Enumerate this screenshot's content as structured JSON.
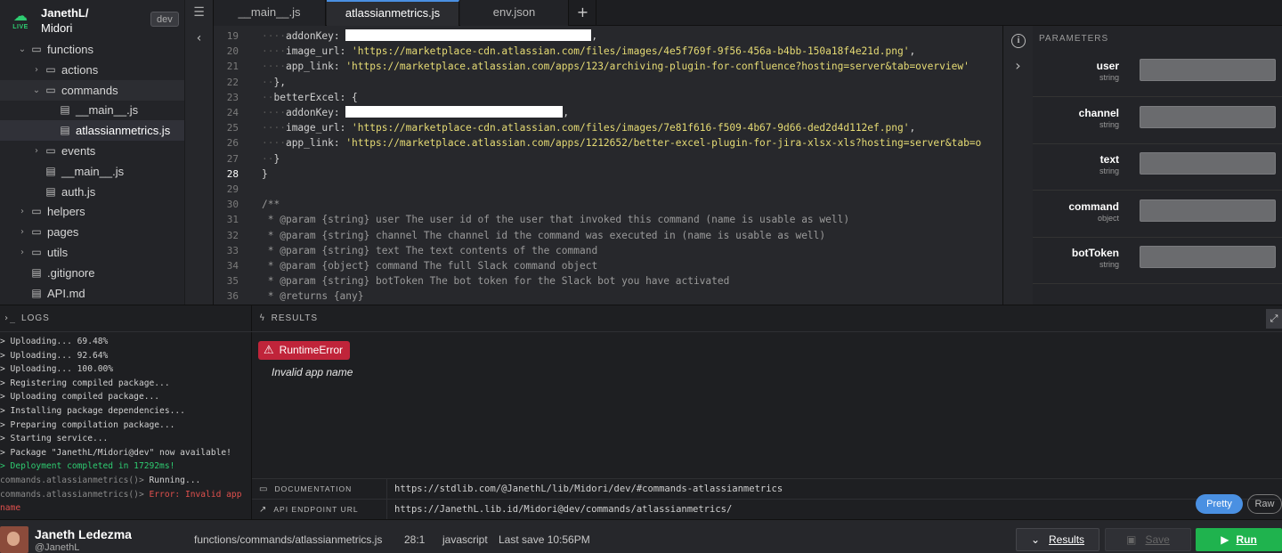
{
  "project": {
    "owner": "JanethL/",
    "app": "Midori",
    "env": "dev",
    "live_label": "LIVE"
  },
  "tree": [
    {
      "label": "functions",
      "type": "folder",
      "depth": 1,
      "open": true
    },
    {
      "label": "actions",
      "type": "folder",
      "depth": 2,
      "open": false
    },
    {
      "label": "commands",
      "type": "folder",
      "depth": 2,
      "open": true
    },
    {
      "label": "__main__.js",
      "type": "file",
      "depth": 3
    },
    {
      "label": "atlassianmetrics.js",
      "type": "file",
      "depth": 3,
      "active": true
    },
    {
      "label": "events",
      "type": "folder",
      "depth": 2,
      "open": false
    },
    {
      "label": "__main__.js",
      "type": "file",
      "depth": 2
    },
    {
      "label": "auth.js",
      "type": "file",
      "depth": 2
    },
    {
      "label": "helpers",
      "type": "folder",
      "depth": 1,
      "open": false
    },
    {
      "label": "pages",
      "type": "folder",
      "depth": 1,
      "open": false
    },
    {
      "label": "utils",
      "type": "folder",
      "depth": 1,
      "open": false
    },
    {
      "label": ".gitignore",
      "type": "file",
      "depth": 1
    },
    {
      "label": "API.md",
      "type": "file",
      "depth": 1
    }
  ],
  "tabs": [
    {
      "label": "__main__.js",
      "active": false
    },
    {
      "label": "atlassianmetrics.js",
      "active": true
    },
    {
      "label": "env.json",
      "active": false
    }
  ],
  "add_tab": "+",
  "editor": {
    "current_line": 28,
    "lines": [
      {
        "n": 19,
        "segs": [
          {
            "t": "ws",
            "v": "····"
          },
          {
            "t": "p",
            "v": "addonKey: "
          },
          {
            "t": "redact",
            "w": 276
          },
          {
            "t": "p",
            "v": ","
          }
        ]
      },
      {
        "n": 20,
        "segs": [
          {
            "t": "ws",
            "v": "····"
          },
          {
            "t": "p",
            "v": "image_url: "
          },
          {
            "t": "str",
            "v": "'https://marketplace-cdn.atlassian.com/files/images/4e5f769f-9f56-456a-b4bb-150a18f4e21d.png'"
          },
          {
            "t": "p",
            "v": ","
          }
        ]
      },
      {
        "n": 21,
        "segs": [
          {
            "t": "ws",
            "v": "····"
          },
          {
            "t": "p",
            "v": "app_link: "
          },
          {
            "t": "str",
            "v": "'https://marketplace.atlassian.com/apps/123/archiving-plugin-for-confluence?hosting=server&tab=overview'"
          }
        ]
      },
      {
        "n": 22,
        "segs": [
          {
            "t": "ws",
            "v": "··"
          },
          {
            "t": "p",
            "v": "},"
          }
        ]
      },
      {
        "n": 23,
        "segs": [
          {
            "t": "ws",
            "v": "··"
          },
          {
            "t": "p",
            "v": "betterExcel: {"
          }
        ]
      },
      {
        "n": 24,
        "segs": [
          {
            "t": "ws",
            "v": "····"
          },
          {
            "t": "p",
            "v": "addonKey: "
          },
          {
            "t": "redact",
            "w": 244
          },
          {
            "t": "p",
            "v": ","
          }
        ]
      },
      {
        "n": 25,
        "segs": [
          {
            "t": "ws",
            "v": "····"
          },
          {
            "t": "p",
            "v": "image_url: "
          },
          {
            "t": "str",
            "v": "'https://marketplace-cdn.atlassian.com/files/images/7e81f616-f509-4b67-9d66-ded2d4d112ef.png'"
          },
          {
            "t": "p",
            "v": ","
          }
        ]
      },
      {
        "n": 26,
        "segs": [
          {
            "t": "ws",
            "v": "····"
          },
          {
            "t": "p",
            "v": "app_link: "
          },
          {
            "t": "str",
            "v": "'https://marketplace.atlassian.com/apps/1212652/better-excel-plugin-for-jira-xlsx-xls?hosting=server&tab=o"
          }
        ]
      },
      {
        "n": 27,
        "segs": [
          {
            "t": "ws",
            "v": "··"
          },
          {
            "t": "p",
            "v": "}"
          }
        ]
      },
      {
        "n": 28,
        "segs": [
          {
            "t": "p",
            "v": "}"
          }
        ]
      },
      {
        "n": 29,
        "segs": []
      },
      {
        "n": 30,
        "segs": [
          {
            "t": "cmt",
            "v": "/**"
          }
        ]
      },
      {
        "n": 31,
        "segs": [
          {
            "t": "cmt",
            "v": " * @param {string} user The user id of the user that invoked this command (name is usable as well)"
          }
        ]
      },
      {
        "n": 32,
        "segs": [
          {
            "t": "cmt",
            "v": " * @param {string} channel The channel id the command was executed in (name is usable as well)"
          }
        ]
      },
      {
        "n": 33,
        "segs": [
          {
            "t": "cmt",
            "v": " * @param {string} text The text contents of the command"
          }
        ]
      },
      {
        "n": 34,
        "segs": [
          {
            "t": "cmt",
            "v": " * @param {object} command The full Slack command object"
          }
        ]
      },
      {
        "n": 35,
        "segs": [
          {
            "t": "cmt",
            "v": " * @param {string} botToken The bot token for the Slack bot you have activated"
          }
        ]
      },
      {
        "n": 36,
        "segs": [
          {
            "t": "cmt",
            "v": " * @returns {any}"
          }
        ]
      }
    ]
  },
  "params": {
    "title": "PARAMETERS",
    "items": [
      {
        "name": "user",
        "type": "string",
        "value": ""
      },
      {
        "name": "channel",
        "type": "string",
        "value": ""
      },
      {
        "name": "text",
        "type": "string",
        "value": ""
      },
      {
        "name": "command",
        "type": "object",
        "value": ""
      },
      {
        "name": "botToken",
        "type": "string",
        "value": ""
      }
    ]
  },
  "logs": {
    "title": "LOGS",
    "prompt_icon": "›_",
    "lines": [
      {
        "kind": "normal",
        "text": "> Uploading... 69.48%"
      },
      {
        "kind": "normal",
        "text": "> Uploading... 92.64%"
      },
      {
        "kind": "normal",
        "text": "> Uploading... 100.00%"
      },
      {
        "kind": "normal",
        "text": "> Registering compiled package..."
      },
      {
        "kind": "normal",
        "text": "> Uploading compiled package..."
      },
      {
        "kind": "normal",
        "text": "> Installing package dependencies..."
      },
      {
        "kind": "normal",
        "text": "> Preparing compilation package..."
      },
      {
        "kind": "normal",
        "text": "> Starting service..."
      },
      {
        "kind": "normal",
        "text": "> Package \"JanethL/Midori@dev\" now available!"
      },
      {
        "kind": "ok",
        "text": "> Deployment completed in 17292ms!"
      },
      {
        "kind": "prompt",
        "prompt": "commands.atlassianmetrics()>",
        "text": " Running..."
      },
      {
        "kind": "error",
        "prompt": "commands.atlassianmetrics()>",
        "text": " Error: Invalid app"
      },
      {
        "kind": "errcont",
        "text": "name"
      }
    ]
  },
  "results": {
    "title": "RESULTS",
    "error_type": "RuntimeError",
    "error_message": "Invalid app name",
    "documentation_label": "DOCUMENTATION",
    "documentation_url": "https://stdlib.com/@JanethL/lib/Midori/dev/#commands-atlassianmetrics",
    "endpoint_label": "API ENDPOINT URL",
    "endpoint_url": "https://JanethL.lib.id/Midori@dev/commands/atlassianmetrics/",
    "view_pretty": "Pretty",
    "view_raw": "Raw"
  },
  "status": {
    "user_name": "Janeth Ledezma",
    "user_handle": "@JanethL",
    "file_path": "functions/commands/atlassianmetrics.js",
    "cursor": "28:1",
    "language": "javascript",
    "last_save": "Last save 10:56PM",
    "results_button": "Results",
    "save_button": "Save",
    "run_button": "Run"
  },
  "colors": {
    "accent": "#4a90e2",
    "run": "#1fb34e",
    "error": "#c0243a",
    "string": "#e6db74",
    "live": "#2ecc71"
  }
}
